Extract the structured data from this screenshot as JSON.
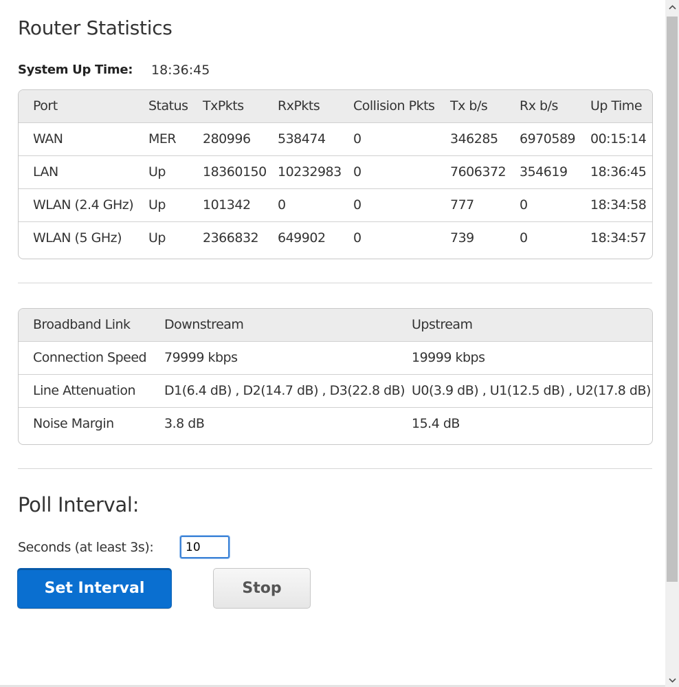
{
  "page": {
    "title": "Router Statistics",
    "system_up_time_label": "System Up Time:",
    "system_up_time_value": "18:36:45"
  },
  "stats_table": {
    "headers": [
      "Port",
      "Status",
      "TxPkts",
      "RxPkts",
      "Collision Pkts",
      "Tx b/s",
      "Rx b/s",
      "Up Time"
    ],
    "rows": [
      [
        "WAN",
        "MER",
        "280996",
        "538474",
        "0",
        "346285",
        "6970589",
        "00:15:14"
      ],
      [
        "LAN",
        "Up",
        "18360150",
        "10232983",
        "0",
        "7606372",
        "354619",
        "18:36:45"
      ],
      [
        "WLAN (2.4 GHz)",
        "Up",
        "101342",
        "0",
        "0",
        "777",
        "0",
        "18:34:58"
      ],
      [
        "WLAN (5 GHz)",
        "Up",
        "2366832",
        "649902",
        "0",
        "739",
        "0",
        "18:34:57"
      ]
    ]
  },
  "broadband_table": {
    "headers": [
      "Broadband Link",
      "Downstream",
      "Upstream"
    ],
    "rows": [
      [
        "Connection Speed",
        "79999 kbps",
        "19999 kbps"
      ],
      [
        "Line Attenuation",
        "D1(6.4 dB) , D2(14.7 dB) , D3(22.8 dB)",
        "U0(3.9 dB) , U1(12.5 dB) , U2(17.8 dB)"
      ],
      [
        "Noise Margin",
        "3.8 dB",
        "15.4 dB"
      ]
    ]
  },
  "poll": {
    "title": "Poll Interval:",
    "seconds_label": "Seconds (at least 3s):",
    "seconds_value": "10",
    "set_button": "Set Interval",
    "stop_button": "Stop"
  },
  "scrollbar": {
    "up_icon": "chevron-up-icon",
    "down_icon": "chevron-down-icon"
  },
  "colors": {
    "primary_button": "#0a6fd0",
    "header_row": "#ececec",
    "input_focus": "#3b82d6"
  }
}
